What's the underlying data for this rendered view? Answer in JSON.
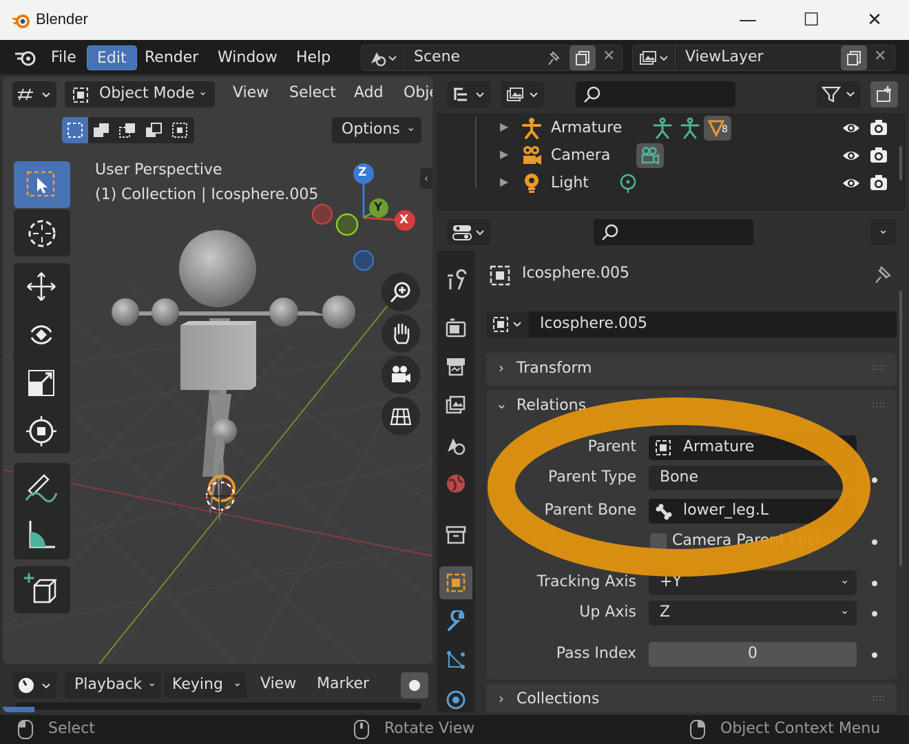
{
  "window": {
    "title": "Blender",
    "minimize": "—",
    "maximize": "☐",
    "close": "✕"
  },
  "menu": {
    "items": [
      "File",
      "Edit",
      "Render",
      "Window",
      "Help"
    ],
    "active": "Edit",
    "scene": "Scene",
    "view_layer": "ViewLayer"
  },
  "viewport": {
    "mode": "Object Mode",
    "menus": [
      "View",
      "Select",
      "Add",
      "Obje"
    ],
    "options": "Options",
    "perspective": "User Perspective",
    "collection": "(1) Collection | Icosphere.005",
    "gizmo": {
      "z": "Z",
      "y": "Y",
      "x": "X"
    }
  },
  "outliner": {
    "rows": [
      {
        "label": "Armature",
        "badge": "8"
      },
      {
        "label": "Camera"
      },
      {
        "label": "Light"
      }
    ]
  },
  "properties": {
    "object_name": "Icosphere.005",
    "data_name": "Icosphere.005",
    "panels": {
      "transform": "Transform",
      "relations": "Relations",
      "collections": "Collections"
    },
    "relations": {
      "parent_label": "Parent",
      "parent_value": "Armature",
      "parent_type_label": "Parent Type",
      "parent_type_value": "Bone",
      "parent_bone_label": "Parent Bone",
      "parent_bone_value": "lower_leg.L",
      "camera_lock_label": "Camera Parent Lock",
      "tracking_axis_label": "Tracking Axis",
      "tracking_axis_value": "+Y",
      "up_axis_label": "Up Axis",
      "up_axis_value": "Z",
      "pass_index_label": "Pass Index",
      "pass_index_value": "0"
    }
  },
  "timeline": {
    "menus": [
      "Playback",
      "Keying",
      "View",
      "Marker"
    ]
  },
  "statusbar": {
    "select": "Select",
    "rotate": "Rotate View",
    "context": "Object Context Menu"
  },
  "colors": {
    "accent": "#4772b3",
    "highlight": "#e0930f",
    "outline_orange": "#e99a2a"
  }
}
